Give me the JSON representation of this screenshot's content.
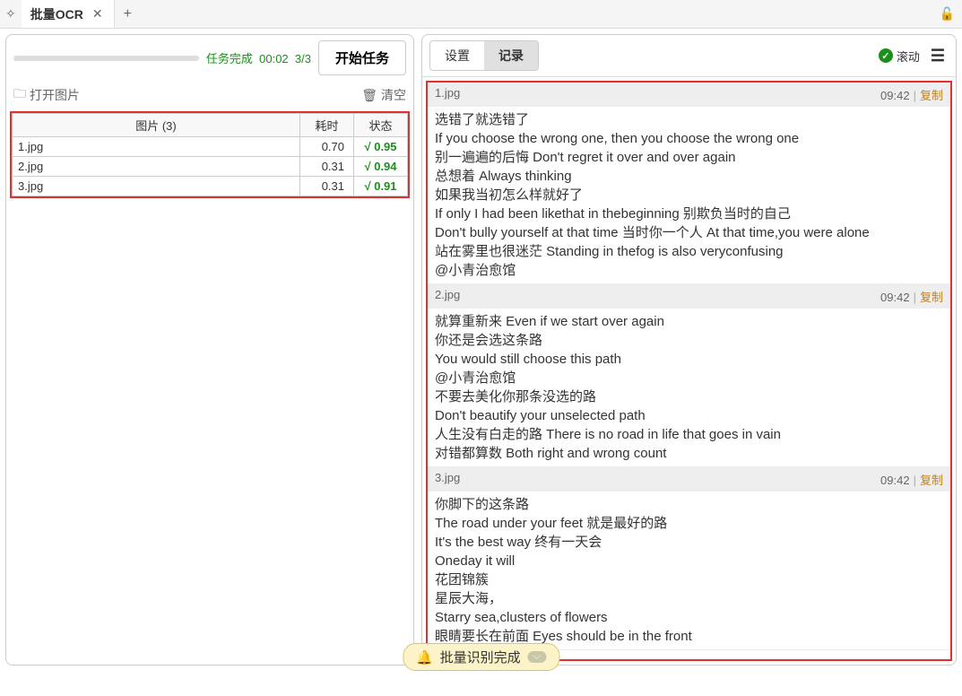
{
  "tabbar": {
    "title": "批量OCR"
  },
  "left": {
    "task_status_prefix": "任务完成",
    "task_time": "00:02",
    "task_progress": "3/3",
    "start_button": "开始任务",
    "open_images": "打开图片",
    "clear": "清空",
    "table": {
      "header_image": "图片 (3)",
      "header_time": "耗时",
      "header_status": "状态",
      "rows": [
        {
          "name": "1.jpg",
          "time": "0.70",
          "status": "√ 0.95"
        },
        {
          "name": "2.jpg",
          "time": "0.31",
          "status": "√ 0.94"
        },
        {
          "name": "3.jpg",
          "time": "0.31",
          "status": "√ 0.91"
        }
      ]
    }
  },
  "right": {
    "tab_settings": "设置",
    "tab_records": "记录",
    "scroll_label": "滚动",
    "copy_label": "复制",
    "records": [
      {
        "file": "1.jpg",
        "time": "09:42",
        "text": "选错了就选错了\nIf you choose the wrong one, then you choose the wrong one\n别一遍遍的后悔 Don't regret it over and over again\n总想着 Always thinking\n如果我当初怎么样就好了\nIf only I had been likethat in thebeginning 别欺负当时的自己\nDon't bully yourself at that time 当时你一个人 At that time,you were alone\n站在雾里也很迷茫 Standing in thefog is also veryconfusing\n@小青治愈馆"
      },
      {
        "file": "2.jpg",
        "time": "09:42",
        "text": "就算重新来 Even if we start over again\n你还是会选这条路\nYou would still choose this path\n@小青治愈馆\n不要去美化你那条没选的路\nDon't beautify your unselected path\n人生没有白走的路 There is no road in life that goes in vain\n对错都算数 Both right and wrong count"
      },
      {
        "file": "3.jpg",
        "time": "09:42",
        "text": "你脚下的这条路\nThe road under your feet 就是最好的路\nIt's the best way 终有一天会\nOneday it will\n花团锦簇\n星辰大海，\nStarry sea,clusters of flowers\n眼睛要长在前面 Eyes should be in the front"
      }
    ]
  },
  "toast": {
    "message": "批量识别完成"
  }
}
